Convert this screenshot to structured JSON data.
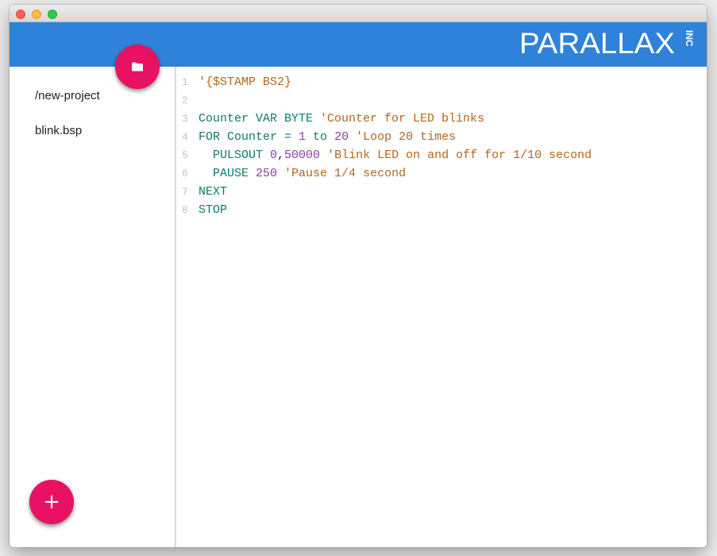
{
  "brand": {
    "logo_text": "PARALLAX",
    "logo_suffix": "INC",
    "appbar_color": "#2f82d9",
    "accent_color": "#e91163"
  },
  "sidebar": {
    "items": [
      {
        "label": "/new-project"
      },
      {
        "label": "blink.bsp"
      }
    ],
    "folder_button_icon": "folder-icon",
    "add_button_label": "+"
  },
  "editor": {
    "lines": [
      {
        "n": "1",
        "tokens": [
          {
            "t": "'{$STAMP BS2}",
            "c": "str"
          }
        ]
      },
      {
        "n": "2",
        "tokens": []
      },
      {
        "n": "3",
        "tokens": [
          {
            "t": "Counter VAR BYTE ",
            "c": "kw"
          },
          {
            "t": "'Counter for LED blinks",
            "c": "str"
          }
        ]
      },
      {
        "n": "4",
        "tokens": [
          {
            "t": "FOR Counter = ",
            "c": "kw"
          },
          {
            "t": "1",
            "c": "num"
          },
          {
            "t": " to ",
            "c": "kw"
          },
          {
            "t": "20",
            "c": "num"
          },
          {
            "t": " ",
            "c": "pl"
          },
          {
            "t": "'Loop 20 times",
            "c": "str"
          }
        ]
      },
      {
        "n": "5",
        "tokens": [
          {
            "t": "  PULSOUT ",
            "c": "kw"
          },
          {
            "t": "0",
            "c": "num"
          },
          {
            "t": ",",
            "c": "pl"
          },
          {
            "t": "50000",
            "c": "num"
          },
          {
            "t": " ",
            "c": "pl"
          },
          {
            "t": "'Blink LED on and off for 1/10 second",
            "c": "str"
          }
        ]
      },
      {
        "n": "6",
        "tokens": [
          {
            "t": "  PAUSE ",
            "c": "kw"
          },
          {
            "t": "250",
            "c": "num"
          },
          {
            "t": " ",
            "c": "pl"
          },
          {
            "t": "'Pause 1/4 second",
            "c": "str"
          }
        ]
      },
      {
        "n": "7",
        "tokens": [
          {
            "t": "NEXT",
            "c": "kw"
          }
        ]
      },
      {
        "n": "8",
        "tokens": [
          {
            "t": "STOP",
            "c": "kw"
          }
        ]
      }
    ]
  }
}
